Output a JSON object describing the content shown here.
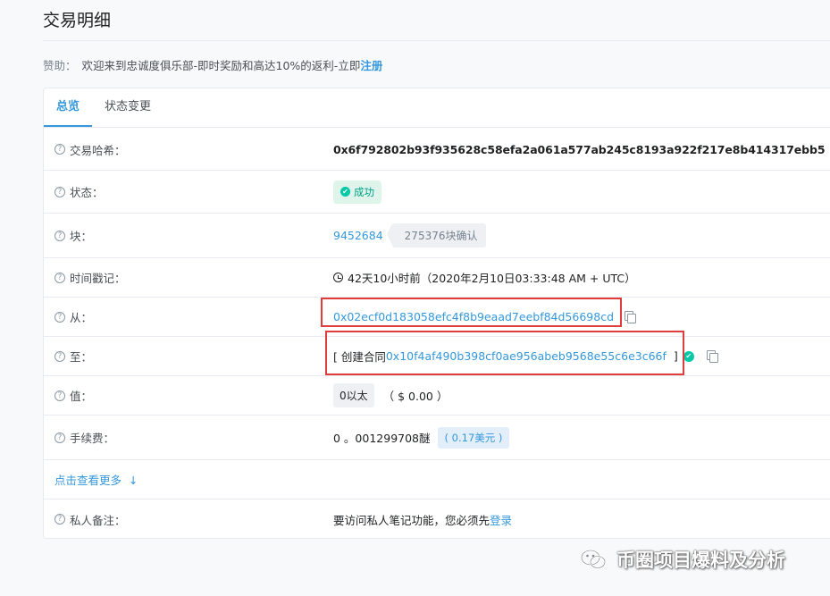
{
  "page": {
    "title": "交易明细",
    "sponsor_label": "赞助：",
    "sponsor_text": "欢迎来到忠诚度俱乐部-即时奖励和高达10%的返利-立即",
    "sponsor_link": "注册"
  },
  "tabs": [
    {
      "label": "总览",
      "active": true
    },
    {
      "label": "状态变更",
      "active": false
    }
  ],
  "rows": {
    "hash": {
      "label": "交易哈希：",
      "value": "0x6f792802b93f935628c58efa2a061a577ab245c8193a922f217e8b414317ebb5"
    },
    "status": {
      "label": "状态：",
      "value": "成功"
    },
    "block": {
      "label": "块：",
      "value": "9452684",
      "confirmations": "275376块确认"
    },
    "timestamp": {
      "label": "时间戳记：",
      "value": "42天10小时前（2020年2月10日03:33:48 AM + UTC）"
    },
    "from": {
      "label": "从：",
      "value": "0x02ecf0d183058efc4f8b9eaad7eebf84d56698cd"
    },
    "to": {
      "label": "至：",
      "prefix": "[ 创建合同",
      "value": "0x10f4af490b398cf0ae956abeb9568e55c6e3c66f",
      "suffix": "]"
    },
    "eth_value": {
      "label": "值：",
      "value": "0以太",
      "usd": "（ $ 0.00 ）"
    },
    "fee": {
      "label": "手续费：",
      "value": "0 。001299708醚",
      "usd": "( 0.17美元 )"
    },
    "more": {
      "label": "点击查看更多",
      "arrow": "↓"
    },
    "note": {
      "label": "私人备注：",
      "text": "要访问私人笔记功能，您必须先",
      "link": "登录"
    }
  },
  "watermark": {
    "text": "币圈项目爆料及分析",
    "icon": "wechat-icon"
  },
  "colors": {
    "accent": "#3498db",
    "success": "#00c9a7",
    "highlight": "#e03c3c"
  }
}
